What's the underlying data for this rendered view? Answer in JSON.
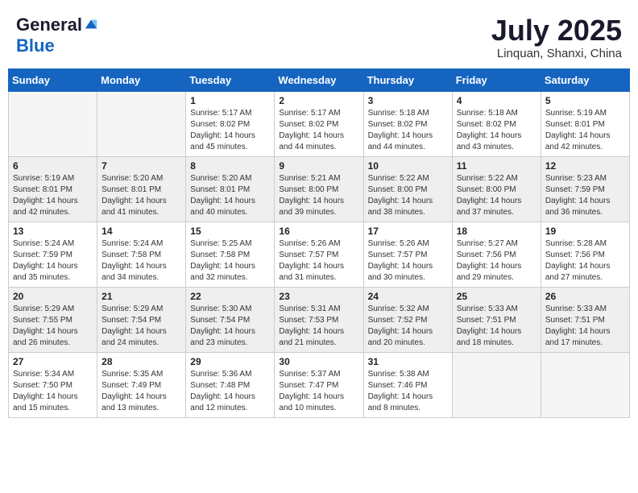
{
  "header": {
    "logo_general": "General",
    "logo_blue": "Blue",
    "month": "July 2025",
    "location": "Linquan, Shanxi, China"
  },
  "days_of_week": [
    "Sunday",
    "Monday",
    "Tuesday",
    "Wednesday",
    "Thursday",
    "Friday",
    "Saturday"
  ],
  "weeks": [
    [
      {
        "num": "",
        "detail": ""
      },
      {
        "num": "",
        "detail": ""
      },
      {
        "num": "1",
        "detail": "Sunrise: 5:17 AM\nSunset: 8:02 PM\nDaylight: 14 hours and 45 minutes."
      },
      {
        "num": "2",
        "detail": "Sunrise: 5:17 AM\nSunset: 8:02 PM\nDaylight: 14 hours and 44 minutes."
      },
      {
        "num": "3",
        "detail": "Sunrise: 5:18 AM\nSunset: 8:02 PM\nDaylight: 14 hours and 44 minutes."
      },
      {
        "num": "4",
        "detail": "Sunrise: 5:18 AM\nSunset: 8:02 PM\nDaylight: 14 hours and 43 minutes."
      },
      {
        "num": "5",
        "detail": "Sunrise: 5:19 AM\nSunset: 8:01 PM\nDaylight: 14 hours and 42 minutes."
      }
    ],
    [
      {
        "num": "6",
        "detail": "Sunrise: 5:19 AM\nSunset: 8:01 PM\nDaylight: 14 hours and 42 minutes."
      },
      {
        "num": "7",
        "detail": "Sunrise: 5:20 AM\nSunset: 8:01 PM\nDaylight: 14 hours and 41 minutes."
      },
      {
        "num": "8",
        "detail": "Sunrise: 5:20 AM\nSunset: 8:01 PM\nDaylight: 14 hours and 40 minutes."
      },
      {
        "num": "9",
        "detail": "Sunrise: 5:21 AM\nSunset: 8:00 PM\nDaylight: 14 hours and 39 minutes."
      },
      {
        "num": "10",
        "detail": "Sunrise: 5:22 AM\nSunset: 8:00 PM\nDaylight: 14 hours and 38 minutes."
      },
      {
        "num": "11",
        "detail": "Sunrise: 5:22 AM\nSunset: 8:00 PM\nDaylight: 14 hours and 37 minutes."
      },
      {
        "num": "12",
        "detail": "Sunrise: 5:23 AM\nSunset: 7:59 PM\nDaylight: 14 hours and 36 minutes."
      }
    ],
    [
      {
        "num": "13",
        "detail": "Sunrise: 5:24 AM\nSunset: 7:59 PM\nDaylight: 14 hours and 35 minutes."
      },
      {
        "num": "14",
        "detail": "Sunrise: 5:24 AM\nSunset: 7:58 PM\nDaylight: 14 hours and 34 minutes."
      },
      {
        "num": "15",
        "detail": "Sunrise: 5:25 AM\nSunset: 7:58 PM\nDaylight: 14 hours and 32 minutes."
      },
      {
        "num": "16",
        "detail": "Sunrise: 5:26 AM\nSunset: 7:57 PM\nDaylight: 14 hours and 31 minutes."
      },
      {
        "num": "17",
        "detail": "Sunrise: 5:26 AM\nSunset: 7:57 PM\nDaylight: 14 hours and 30 minutes."
      },
      {
        "num": "18",
        "detail": "Sunrise: 5:27 AM\nSunset: 7:56 PM\nDaylight: 14 hours and 29 minutes."
      },
      {
        "num": "19",
        "detail": "Sunrise: 5:28 AM\nSunset: 7:56 PM\nDaylight: 14 hours and 27 minutes."
      }
    ],
    [
      {
        "num": "20",
        "detail": "Sunrise: 5:29 AM\nSunset: 7:55 PM\nDaylight: 14 hours and 26 minutes."
      },
      {
        "num": "21",
        "detail": "Sunrise: 5:29 AM\nSunset: 7:54 PM\nDaylight: 14 hours and 24 minutes."
      },
      {
        "num": "22",
        "detail": "Sunrise: 5:30 AM\nSunset: 7:54 PM\nDaylight: 14 hours and 23 minutes."
      },
      {
        "num": "23",
        "detail": "Sunrise: 5:31 AM\nSunset: 7:53 PM\nDaylight: 14 hours and 21 minutes."
      },
      {
        "num": "24",
        "detail": "Sunrise: 5:32 AM\nSunset: 7:52 PM\nDaylight: 14 hours and 20 minutes."
      },
      {
        "num": "25",
        "detail": "Sunrise: 5:33 AM\nSunset: 7:51 PM\nDaylight: 14 hours and 18 minutes."
      },
      {
        "num": "26",
        "detail": "Sunrise: 5:33 AM\nSunset: 7:51 PM\nDaylight: 14 hours and 17 minutes."
      }
    ],
    [
      {
        "num": "27",
        "detail": "Sunrise: 5:34 AM\nSunset: 7:50 PM\nDaylight: 14 hours and 15 minutes."
      },
      {
        "num": "28",
        "detail": "Sunrise: 5:35 AM\nSunset: 7:49 PM\nDaylight: 14 hours and 13 minutes."
      },
      {
        "num": "29",
        "detail": "Sunrise: 5:36 AM\nSunset: 7:48 PM\nDaylight: 14 hours and 12 minutes."
      },
      {
        "num": "30",
        "detail": "Sunrise: 5:37 AM\nSunset: 7:47 PM\nDaylight: 14 hours and 10 minutes."
      },
      {
        "num": "31",
        "detail": "Sunrise: 5:38 AM\nSunset: 7:46 PM\nDaylight: 14 hours and 8 minutes."
      },
      {
        "num": "",
        "detail": ""
      },
      {
        "num": "",
        "detail": ""
      }
    ]
  ]
}
